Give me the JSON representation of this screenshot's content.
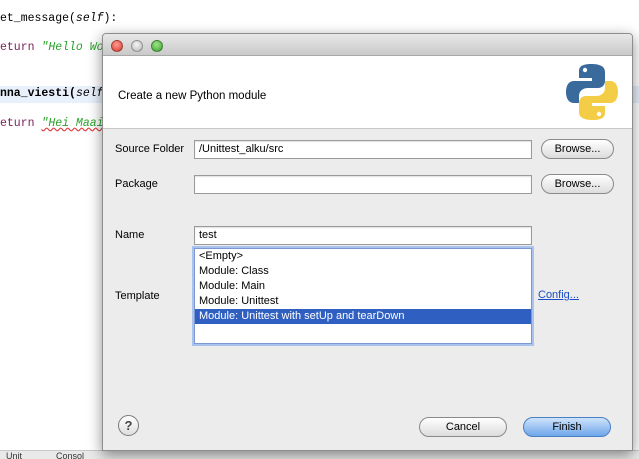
{
  "editor": {
    "line1": {
      "prefix": "et_message(",
      "self": "self",
      "suffix": "):"
    },
    "line2": {
      "keyword": "eturn",
      "string": "\"Hello Wo"
    },
    "line3": {
      "name": "nna_viest",
      "name_tail": "i(",
      "self": "self"
    },
    "line4": {
      "keyword": "eturn",
      "string": "\"Hei Maai"
    },
    "bottom_tabs": [
      "Unit",
      "Consol"
    ]
  },
  "dialog": {
    "header_title": "Create a new Python module",
    "source_folder_label": "Source Folder",
    "source_folder_value": "/Unittest_alku/src",
    "browse_label": "Browse...",
    "package_label": "Package",
    "package_value": "",
    "name_label": "Name",
    "name_value": "test",
    "template_label": "Template",
    "template_options": [
      "<Empty>",
      "Module: Class",
      "Module: Main",
      "Module: Unittest",
      "Module: Unittest with setUp and tearDown"
    ],
    "template_selected": "Module: Unittest with setUp and tearDown",
    "config_link": "Config...",
    "help_label": "?",
    "cancel_label": "Cancel",
    "finish_label": "Finish"
  },
  "colors": {
    "selection": "#2f5fc1",
    "link": "#1a4fc4",
    "primary_button": "#6ea6ea",
    "python_blue": "#3a6a9c",
    "python_yellow": "#f4cd46"
  }
}
